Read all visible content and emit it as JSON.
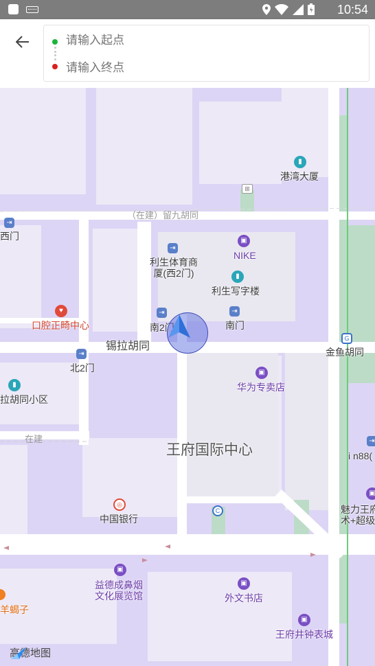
{
  "status_bar": {
    "time": "10:54"
  },
  "search": {
    "start_placeholder": "请输入起点",
    "end_placeholder": "请输入终点"
  },
  "map": {
    "labels": {
      "gangwan": "港湾大厦",
      "liujiu": "（在建）留九胡同",
      "ximen": "西门",
      "nike": "NIKE",
      "lisheng_sports": "利生体育商\n厦(西2门)",
      "lisheng_office": "利生写字楼",
      "dental": "口腔正畸中心",
      "south2": "南2门",
      "south": "南门",
      "xila": "锡拉胡同",
      "jinyu": "金鱼胡同",
      "north2": "北2门",
      "huawei": "华为专卖店",
      "lahutong": "拉胡同小区",
      "zaijian": "在建",
      "wangfu_center": "王府国际中心",
      "in88": "i n88(",
      "meili": "魅力王府\n术+超级",
      "bank": "中国银行",
      "yidecheng": "益德成鼻烟\n文化展览馆",
      "waiwen": "外文书店",
      "yangxiezi": "羊蝎子",
      "wangfujing_watch": "王府井钟表城"
    },
    "logo": "高德地图"
  },
  "colors": {
    "map_bg": "#ddd5f5",
    "road": "#ffffff",
    "block": "#efeef2",
    "green": "#b9dcc6",
    "metro_line": "#6ccc7a",
    "poi_purple": "#7a4fc4",
    "locator": "#3b6fe0"
  }
}
